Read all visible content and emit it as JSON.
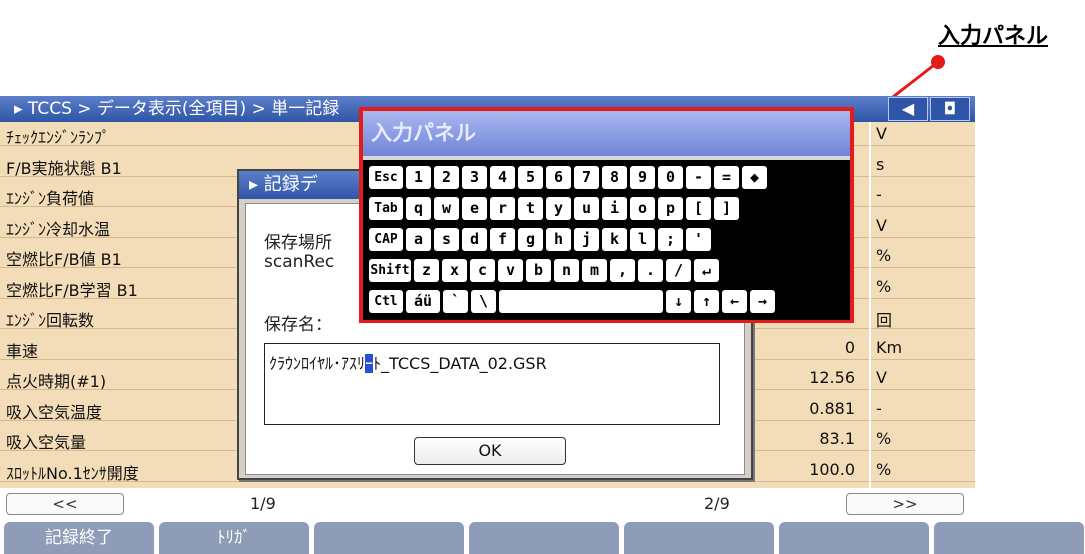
{
  "callout": {
    "label": "入力パネル"
  },
  "window": {
    "breadcrumb": "▸ TCCS > データ表示(全項目) > 単一記録",
    "back_icon": "◀",
    "camera_icon": "◘"
  },
  "table": {
    "rows": [
      {
        "name": "ﾁｪｯｸｴﾝｼﾞﾝﾗﾝﾌﾟ",
        "value": "",
        "unit": "V"
      },
      {
        "name": "F/B実施状態 B1",
        "value": "",
        "unit": "s"
      },
      {
        "name": "ｴﾝｼﾞﾝ負荷値",
        "value": "",
        "unit": "-"
      },
      {
        "name": "ｴﾝｼﾞﾝ冷却水温",
        "value": "",
        "unit": "V"
      },
      {
        "name": "空燃比F/B値 B1",
        "value": "",
        "unit": "%"
      },
      {
        "name": "空燃比F/B学習 B1",
        "value": "",
        "unit": "%"
      },
      {
        "name": "ｴﾝｼﾞﾝ回転数",
        "value": "0",
        "unit": "回"
      },
      {
        "name": "車速",
        "value": "0",
        "unit": "Km"
      },
      {
        "name": "点火時期(#1)",
        "value": "12.56",
        "unit": "V"
      },
      {
        "name": "吸入空気温度",
        "value": "0.881",
        "unit": "-"
      },
      {
        "name": "吸入空気量",
        "value": "83.1",
        "unit": "%"
      },
      {
        "name": "ｽﾛｯﾄﾙNo.1ｾﾝｻ開度",
        "value": "100.0",
        "unit": "%"
      }
    ]
  },
  "pager": {
    "prev": "<<",
    "next": ">>",
    "page_left": "1/9",
    "page_right": "2/9"
  },
  "fkeys": [
    "記録終了",
    "ﾄﾘｶﾞ",
    "",
    "",
    "",
    "",
    ""
  ],
  "dialog": {
    "title": "▸ 記録デ",
    "location_label": "保存場所",
    "location_value": "scanRec",
    "name_label": "保存名：",
    "name_before": "ｸﾗｳﾝﾛｲﾔﾙ･ｱｽﾘ",
    "name_caret": "ｰ",
    "name_after": "ﾄ_TCCS_DATA_02.GSR",
    "ok": "OK"
  },
  "panel": {
    "title": "入力パネル",
    "rows": [
      [
        "Esc",
        "1",
        "2",
        "3",
        "4",
        "5",
        "6",
        "7",
        "8",
        "9",
        "0",
        "-",
        "=",
        "◆"
      ],
      [
        "Tab",
        "q",
        "w",
        "e",
        "r",
        "t",
        "y",
        "u",
        "i",
        "o",
        "p",
        "[",
        "]"
      ],
      [
        "CAP",
        "a",
        "s",
        "d",
        "f",
        "g",
        "h",
        "j",
        "k",
        "l",
        ";",
        "'"
      ],
      [
        "Shift",
        "z",
        "x",
        "c",
        "v",
        "b",
        "n",
        "m",
        ",",
        ".",
        "/",
        "↵"
      ],
      [
        "Ctl",
        "áü",
        "`",
        "\\",
        "",
        "↓",
        "↑",
        "←",
        "→"
      ]
    ]
  }
}
